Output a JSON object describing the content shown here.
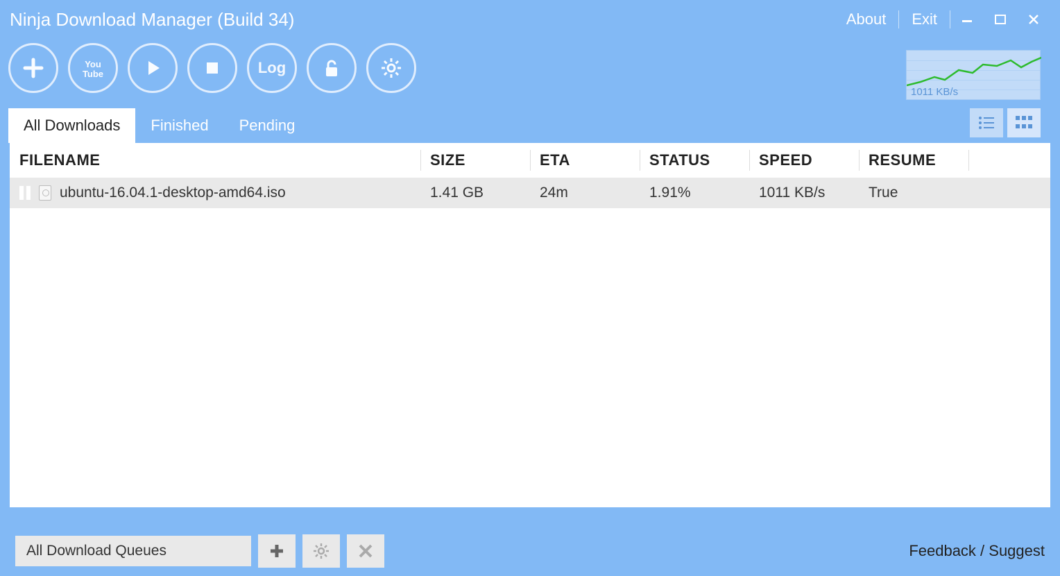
{
  "title": "Ninja Download Manager (Build 34)",
  "titlebar": {
    "about": "About",
    "exit": "Exit"
  },
  "toolbar": {
    "log_label": "Log"
  },
  "speed_graph": {
    "label": "1011 KB/s"
  },
  "tabs": {
    "all_downloads": "All Downloads",
    "finished": "Finished",
    "pending": "Pending"
  },
  "columns": {
    "filename": "FILENAME",
    "size": "SIZE",
    "eta": "ETA",
    "status": "STATUS",
    "speed": "SPEED",
    "resume": "RESUME"
  },
  "downloads": [
    {
      "filename": "ubuntu-16.04.1-desktop-amd64.iso",
      "size": "1.41 GB",
      "eta": "24m",
      "status": "1.91%",
      "speed": "1011 KB/s",
      "resume": "True"
    }
  ],
  "bottombar": {
    "queue_label": "All Download Queues",
    "feedback": "Feedback / Suggest"
  }
}
